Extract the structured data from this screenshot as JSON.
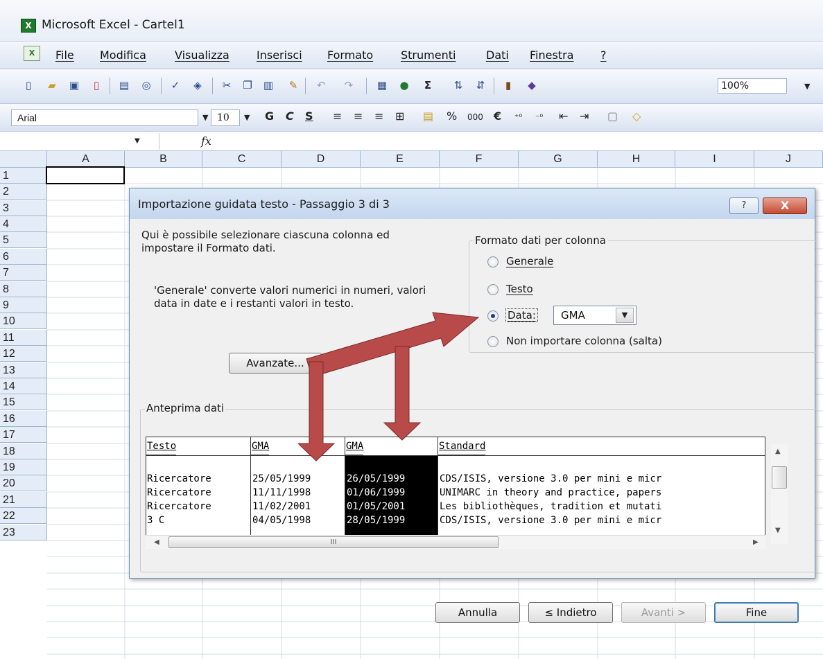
{
  "window": {
    "title": "Microsoft Excel - Cartel1",
    "app_icon_glyph": "X"
  },
  "menu": {
    "items": [
      "File",
      "Modifica",
      "Visualizza",
      "Inserisci",
      "Formato",
      "Strumenti",
      "Dati",
      "Finestra",
      "?"
    ]
  },
  "toolbar": {
    "icons": [
      "new-icon",
      "open-icon",
      "save-icon",
      "permission-icon",
      "print-icon",
      "print-preview-icon",
      "spelling-icon",
      "research-icon",
      "cut-icon",
      "copy-icon",
      "paste-icon",
      "format-painter-icon",
      "undo-icon",
      "redo-icon",
      "hyperlink-icon",
      "chart-icon",
      "autosum-icon",
      "sort-asc-icon",
      "sort-desc-icon",
      "chart-wizard-icon",
      "drawing-icon"
    ],
    "zoom": "100%",
    "font_name": "Arial",
    "font_size": "10",
    "bold_label": "G",
    "italic_label": "C",
    "underline_label": "S",
    "percent_label": "%",
    "thousands_label": "000",
    "euro_label": "€"
  },
  "formula_bar": {
    "fx_label": "fx"
  },
  "grid": {
    "columns": [
      "A",
      "B",
      "C",
      "D",
      "E",
      "F",
      "G",
      "H",
      "I",
      "J"
    ],
    "rows": [
      "1",
      "2",
      "3",
      "4",
      "5",
      "6",
      "7",
      "8",
      "9",
      "10",
      "11",
      "12",
      "13",
      "14",
      "15",
      "16",
      "17",
      "18",
      "19",
      "20",
      "21",
      "22",
      "23"
    ]
  },
  "dialog": {
    "title": "Importazione guidata testo - Passaggio 3 di 3",
    "help_label": "?",
    "close_label": "X",
    "intro_line1": "Qui è possibile selezionare ciascuna colonna ed",
    "intro_line2": "impostare il Formato dati.",
    "note_line1": "'Generale' converte valori numerici in numeri, valori",
    "note_line2": "data in date e i restanti valori in testo.",
    "advanced_button": "Avanzate...",
    "format_group": {
      "label": "Formato dati per colonna",
      "options": [
        "Generale",
        "Testo",
        "Data:",
        "Non importare colonna (salta)"
      ],
      "selected": "Data:",
      "date_format": "GMA"
    },
    "preview": {
      "label": "Anteprima dati",
      "headers": [
        "Testo",
        "GMA",
        "GMA",
        "Standard"
      ],
      "rows": [
        [
          "Ricercatore",
          "25/05/1999",
          "26/05/1999",
          "CDS/ISIS, versione 3.0 per mini e micr"
        ],
        [
          "Ricercatore",
          "11/11/1998",
          "01/06/1999",
          "UNIMARC in theory and practice, papers"
        ],
        [
          "Ricercatore",
          "11/02/2001",
          "01/05/2001",
          "Les bibliothèques, tradition et mutati"
        ],
        [
          "3 C",
          "04/05/1998",
          "28/05/1999",
          "CDS/ISIS, versione 3.0 per mini e micr"
        ]
      ],
      "hscroll_grip": "III"
    },
    "buttons": {
      "cancel": "Annulla",
      "back": "≤ Indietro",
      "next": "Avanti >",
      "finish": "Fine"
    }
  },
  "annotation": {
    "arrow_color": "#b84a4a"
  }
}
